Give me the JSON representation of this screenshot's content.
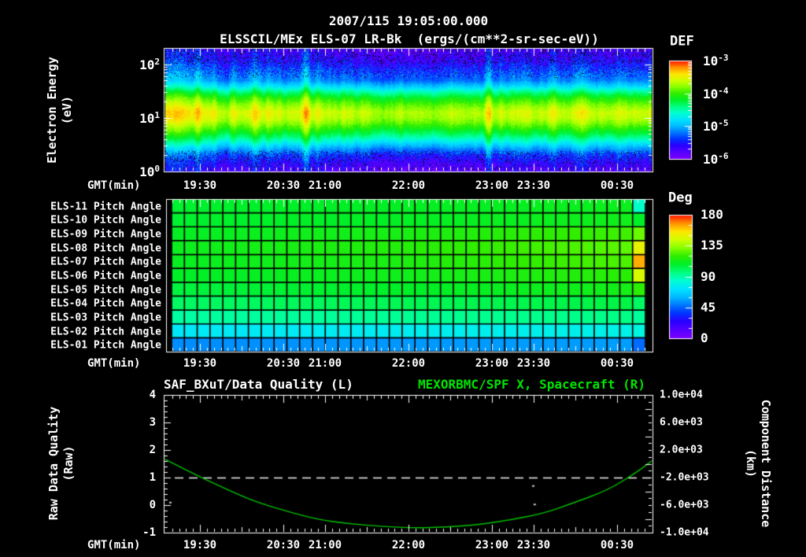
{
  "palette": [
    "#7a00ff",
    "#5500ff",
    "#2a00ff",
    "#0033ff",
    "#0077ff",
    "#00bbff",
    "#00e4ff",
    "#00ffd0",
    "#00ff80",
    "#00f028",
    "#30ee00",
    "#86ff00",
    "#d0ff00",
    "#ffe600",
    "#ff9100",
    "#ff1500"
  ],
  "header": {
    "datetime": "2007/115 19:05:00.000",
    "instrument_title": "ELSSCIL/MEx ELS-07 LR-Bk  (ergs/(cm**2-sr-sec-eV))"
  },
  "time_axis": {
    "label": "GMT(min)",
    "tick_labels": [
      "19:30",
      "20:30",
      "21:00",
      "22:00",
      "23:00",
      "23:30",
      "00:30"
    ],
    "start": "19:05",
    "end": "00:55"
  },
  "spectrogram": {
    "ylabel_line1": "Electron Energy",
    "ylabel_line2": "(eV)",
    "ytick_exponents": [
      0,
      1,
      2
    ],
    "colorbar_label": "DEF",
    "colorbar_tick_exponents": [
      -3,
      -4,
      -5,
      -6
    ]
  },
  "pitch_panel": {
    "row_labels": [
      "ELS-11 Pitch Angle",
      "ELS-10 Pitch Angle",
      "ELS-09 Pitch Angle",
      "ELS-08 Pitch Angle",
      "ELS-07 Pitch Angle",
      "ELS-06 Pitch Angle",
      "ELS-05 Pitch Angle",
      "ELS-04 Pitch Angle",
      "ELS-03 Pitch Angle",
      "ELS-02 Pitch Angle",
      "ELS-01 Pitch Angle"
    ],
    "colorbar_label": "Deg",
    "colorbar_ticks": [
      "180",
      "135",
      "90",
      "45",
      "0"
    ]
  },
  "bottom_panel": {
    "left_title": "SAF_BXuT/Data Quality (L)",
    "right_title": "MEXORBMC/SPF X, Spacecraft (R)",
    "left_ylabel_line1": "Raw Data Quality",
    "left_ylabel_line2": "(Raw)",
    "right_ylabel_line1": "Component Distance",
    "right_ylabel_line2": "(km)",
    "left_tick_labels": [
      "4",
      "3",
      "2",
      "1",
      "0",
      "-1"
    ],
    "right_tick_labels": [
      "1.0e+04",
      "6.0e+03",
      "2.0e+03",
      "-2.0e+03",
      "-6.0e+03",
      "-1.0e+04"
    ]
  },
  "chart_data": [
    {
      "type": "heatmap",
      "name": "electron-energy-spectrogram",
      "title": "ELSSCIL/MEx ELS-07 LR-Bk",
      "units": "ergs/(cm**2-sr-sec-eV)",
      "x_start": "19:05",
      "x_end": "00:55",
      "ylabel": "Electron Energy (eV)",
      "yscale": "log",
      "ylim": [
        1,
        195
      ],
      "zlabel": "DEF",
      "zscale": "log",
      "zlim": [
        1e-06,
        0.001
      ],
      "energy_flux_profile": [
        [
          200,
          1.8e-06
        ],
        [
          120,
          2.5e-06
        ],
        [
          70,
          5e-06
        ],
        [
          50,
          7e-06
        ],
        [
          38,
          1.6e-05
        ],
        [
          30,
          4e-05
        ],
        [
          24,
          8e-05
        ],
        [
          18,
          0.00015
        ],
        [
          13,
          0.00026
        ],
        [
          10,
          0.00023
        ],
        [
          8,
          0.00016
        ],
        [
          6.5,
          0.0001
        ],
        [
          5,
          5.5e-05
        ],
        [
          4,
          3e-05
        ],
        [
          3.2,
          1.5e-05
        ],
        [
          2.6,
          8e-06
        ],
        [
          2,
          4e-06
        ],
        [
          1.5,
          2.4e-06
        ],
        [
          1,
          1.7e-06
        ]
      ],
      "brightness_events": [
        {
          "f": 0.015,
          "amp": 0.28,
          "sig": 0.03
        },
        {
          "f": 0.065,
          "amp": 0.22,
          "sig": 0.006
        },
        {
          "f": 0.1,
          "amp": 0.18,
          "sig": 0.005
        },
        {
          "f": 0.14,
          "amp": 0.15,
          "sig": 0.004
        },
        {
          "f": 0.185,
          "amp": 0.3,
          "sig": 0.008
        },
        {
          "f": 0.21,
          "amp": 0.18,
          "sig": 0.004
        },
        {
          "f": 0.235,
          "amp": 0.12,
          "sig": 0.004
        },
        {
          "f": 0.29,
          "amp": 0.42,
          "sig": 0.006
        },
        {
          "f": 0.315,
          "amp": 0.2,
          "sig": 0.004
        },
        {
          "f": 0.5,
          "amp": -0.14,
          "sig": 0.09
        },
        {
          "f": 0.665,
          "amp": 0.3,
          "sig": 0.005
        },
        {
          "f": 0.69,
          "amp": 0.15,
          "sig": 0.004
        },
        {
          "f": 0.8,
          "amp": 0.18,
          "sig": 0.01
        },
        {
          "f": 0.86,
          "amp": 0.12,
          "sig": 0.01
        },
        {
          "f": 0.95,
          "amp": 0.1,
          "sig": 0.02
        }
      ]
    },
    {
      "type": "heatmap",
      "name": "pitch-angle-panels",
      "units": "deg",
      "color_range": [
        0,
        180
      ],
      "columns": 37,
      "angle_keys": [
        "start",
        "middle",
        "end",
        "final_column"
      ],
      "rows": [
        {
          "label": "ELS-11 Pitch Angle",
          "angles_deg": [
            107,
            109,
            111,
            85
          ]
        },
        {
          "label": "ELS-10 Pitch Angle",
          "angles_deg": [
            107,
            109,
            112,
            108
          ]
        },
        {
          "label": "ELS-09 Pitch Angle",
          "angles_deg": [
            109,
            114,
            122,
            128
          ]
        },
        {
          "label": "ELS-08 Pitch Angle",
          "angles_deg": [
            111,
            117,
            126,
            150
          ]
        },
        {
          "label": "ELS-07 Pitch Angle",
          "angles_deg": [
            110,
            115,
            124,
            164
          ]
        },
        {
          "label": "ELS-06 Pitch Angle",
          "angles_deg": [
            108,
            112,
            118,
            146
          ]
        },
        {
          "label": "ELS-05 Pitch Angle",
          "angles_deg": [
            105,
            108,
            113,
            119
          ]
        },
        {
          "label": "ELS-04 Pitch Angle",
          "angles_deg": [
            100,
            102,
            104,
            100
          ]
        },
        {
          "label": "ELS-03 Pitch Angle",
          "angles_deg": [
            91,
            93,
            95,
            92
          ]
        },
        {
          "label": "ELS-02 Pitch Angle",
          "angles_deg": [
            74,
            76,
            78,
            80
          ]
        },
        {
          "label": "ELS-01 Pitch Angle",
          "angles_deg": [
            52,
            54,
            55,
            46
          ]
        }
      ]
    },
    {
      "type": "line",
      "name": "quality-and-distance",
      "series": [
        {
          "name": "SAF_BXuT/Data Quality",
          "axis": "left",
          "style": "dashed",
          "color": "#eeeeee",
          "ylim": [
            -1,
            4
          ],
          "value_constant": 1
        },
        {
          "name": "MEXORBMC/SPF X, Spacecraft",
          "axis": "right",
          "style": "solid",
          "color": "#00c400",
          "ylim": [
            -10000,
            10000
          ],
          "points_frac_km": [
            [
              0,
              630
            ],
            [
              0.05,
              -1200
            ],
            [
              0.12,
              -3500
            ],
            [
              0.18,
              -5400
            ],
            [
              0.25,
              -6900
            ],
            [
              0.31,
              -8050
            ],
            [
              0.38,
              -8750
            ],
            [
              0.45,
              -9100
            ],
            [
              0.51,
              -9320
            ],
            [
              0.58,
              -9200
            ],
            [
              0.64,
              -8860
            ],
            [
              0.71,
              -8170
            ],
            [
              0.78,
              -7150
            ],
            [
              0.84,
              -5660
            ],
            [
              0.91,
              -3830
            ],
            [
              0.97,
              -1200
            ],
            [
              1,
              430
            ]
          ]
        }
      ],
      "noise_marks_frac_raw": [
        [
          0.754,
          0.72
        ],
        [
          0.757,
          0.05
        ],
        [
          0.008,
          0.12
        ]
      ]
    }
  ]
}
